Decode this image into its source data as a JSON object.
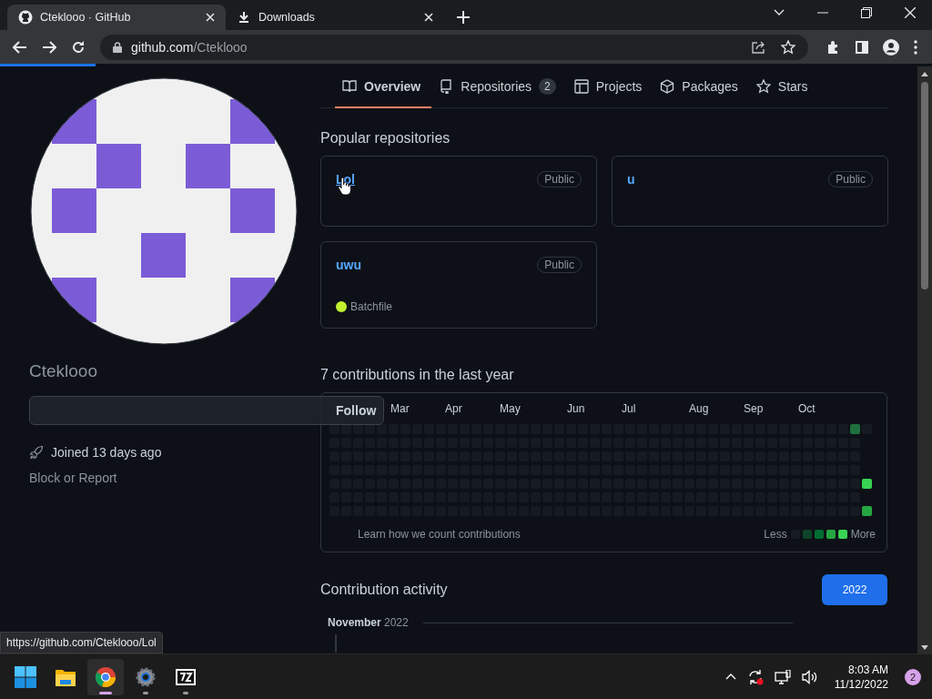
{
  "browser": {
    "tabs": [
      {
        "title": "Cteklooo · GitHub",
        "selected": true
      },
      {
        "title": "Downloads",
        "selected": false
      }
    ],
    "url": {
      "host": "github.com",
      "path": "/Cteklooo"
    },
    "status_url": "https://github.com/Cteklooo/Lol"
  },
  "profile": {
    "username": "Cteklooo",
    "follow": "Follow",
    "joined": "Joined 13 days ago",
    "block": "Block or Report"
  },
  "nav": [
    {
      "label": "Overview",
      "selected": true
    },
    {
      "label": "Repositories",
      "count": "2",
      "selected": false
    },
    {
      "label": "Projects",
      "selected": false
    },
    {
      "label": "Packages",
      "selected": false
    },
    {
      "label": "Stars",
      "selected": false
    }
  ],
  "popular": {
    "title": "Popular repositories",
    "repos": [
      {
        "name": "Lol",
        "visibility": "Public",
        "hovered": true
      },
      {
        "name": "u",
        "visibility": "Public",
        "hovered": false
      },
      {
        "name": "uwu",
        "visibility": "Public",
        "hovered": false,
        "language": "Batchfile",
        "color": "#c1f12e"
      }
    ]
  },
  "contributions": {
    "title": "7 contributions in the last year",
    "months": [
      "Mar",
      "Apr",
      "May",
      "Jun",
      "Jul",
      "Aug",
      "Sep",
      "Oct"
    ],
    "learn": "Learn how we count contributions",
    "less": "Less",
    "more": "More"
  },
  "activity": {
    "title": "Contribution activity",
    "years": [
      {
        "label": "2022",
        "selected": true
      }
    ],
    "month": "November",
    "year": "2022"
  },
  "taskbar": {
    "apps": [
      {
        "kind": "start",
        "active": false,
        "running": false
      },
      {
        "kind": "explorer",
        "active": false,
        "running": false
      },
      {
        "kind": "chrome",
        "active": true,
        "running": true
      },
      {
        "kind": "settings",
        "active": false,
        "running": true
      },
      {
        "kind": "archiver",
        "active": false,
        "running": true
      }
    ],
    "time": "8:03 AM",
    "date": "11/12/2022",
    "notifications": "2"
  }
}
